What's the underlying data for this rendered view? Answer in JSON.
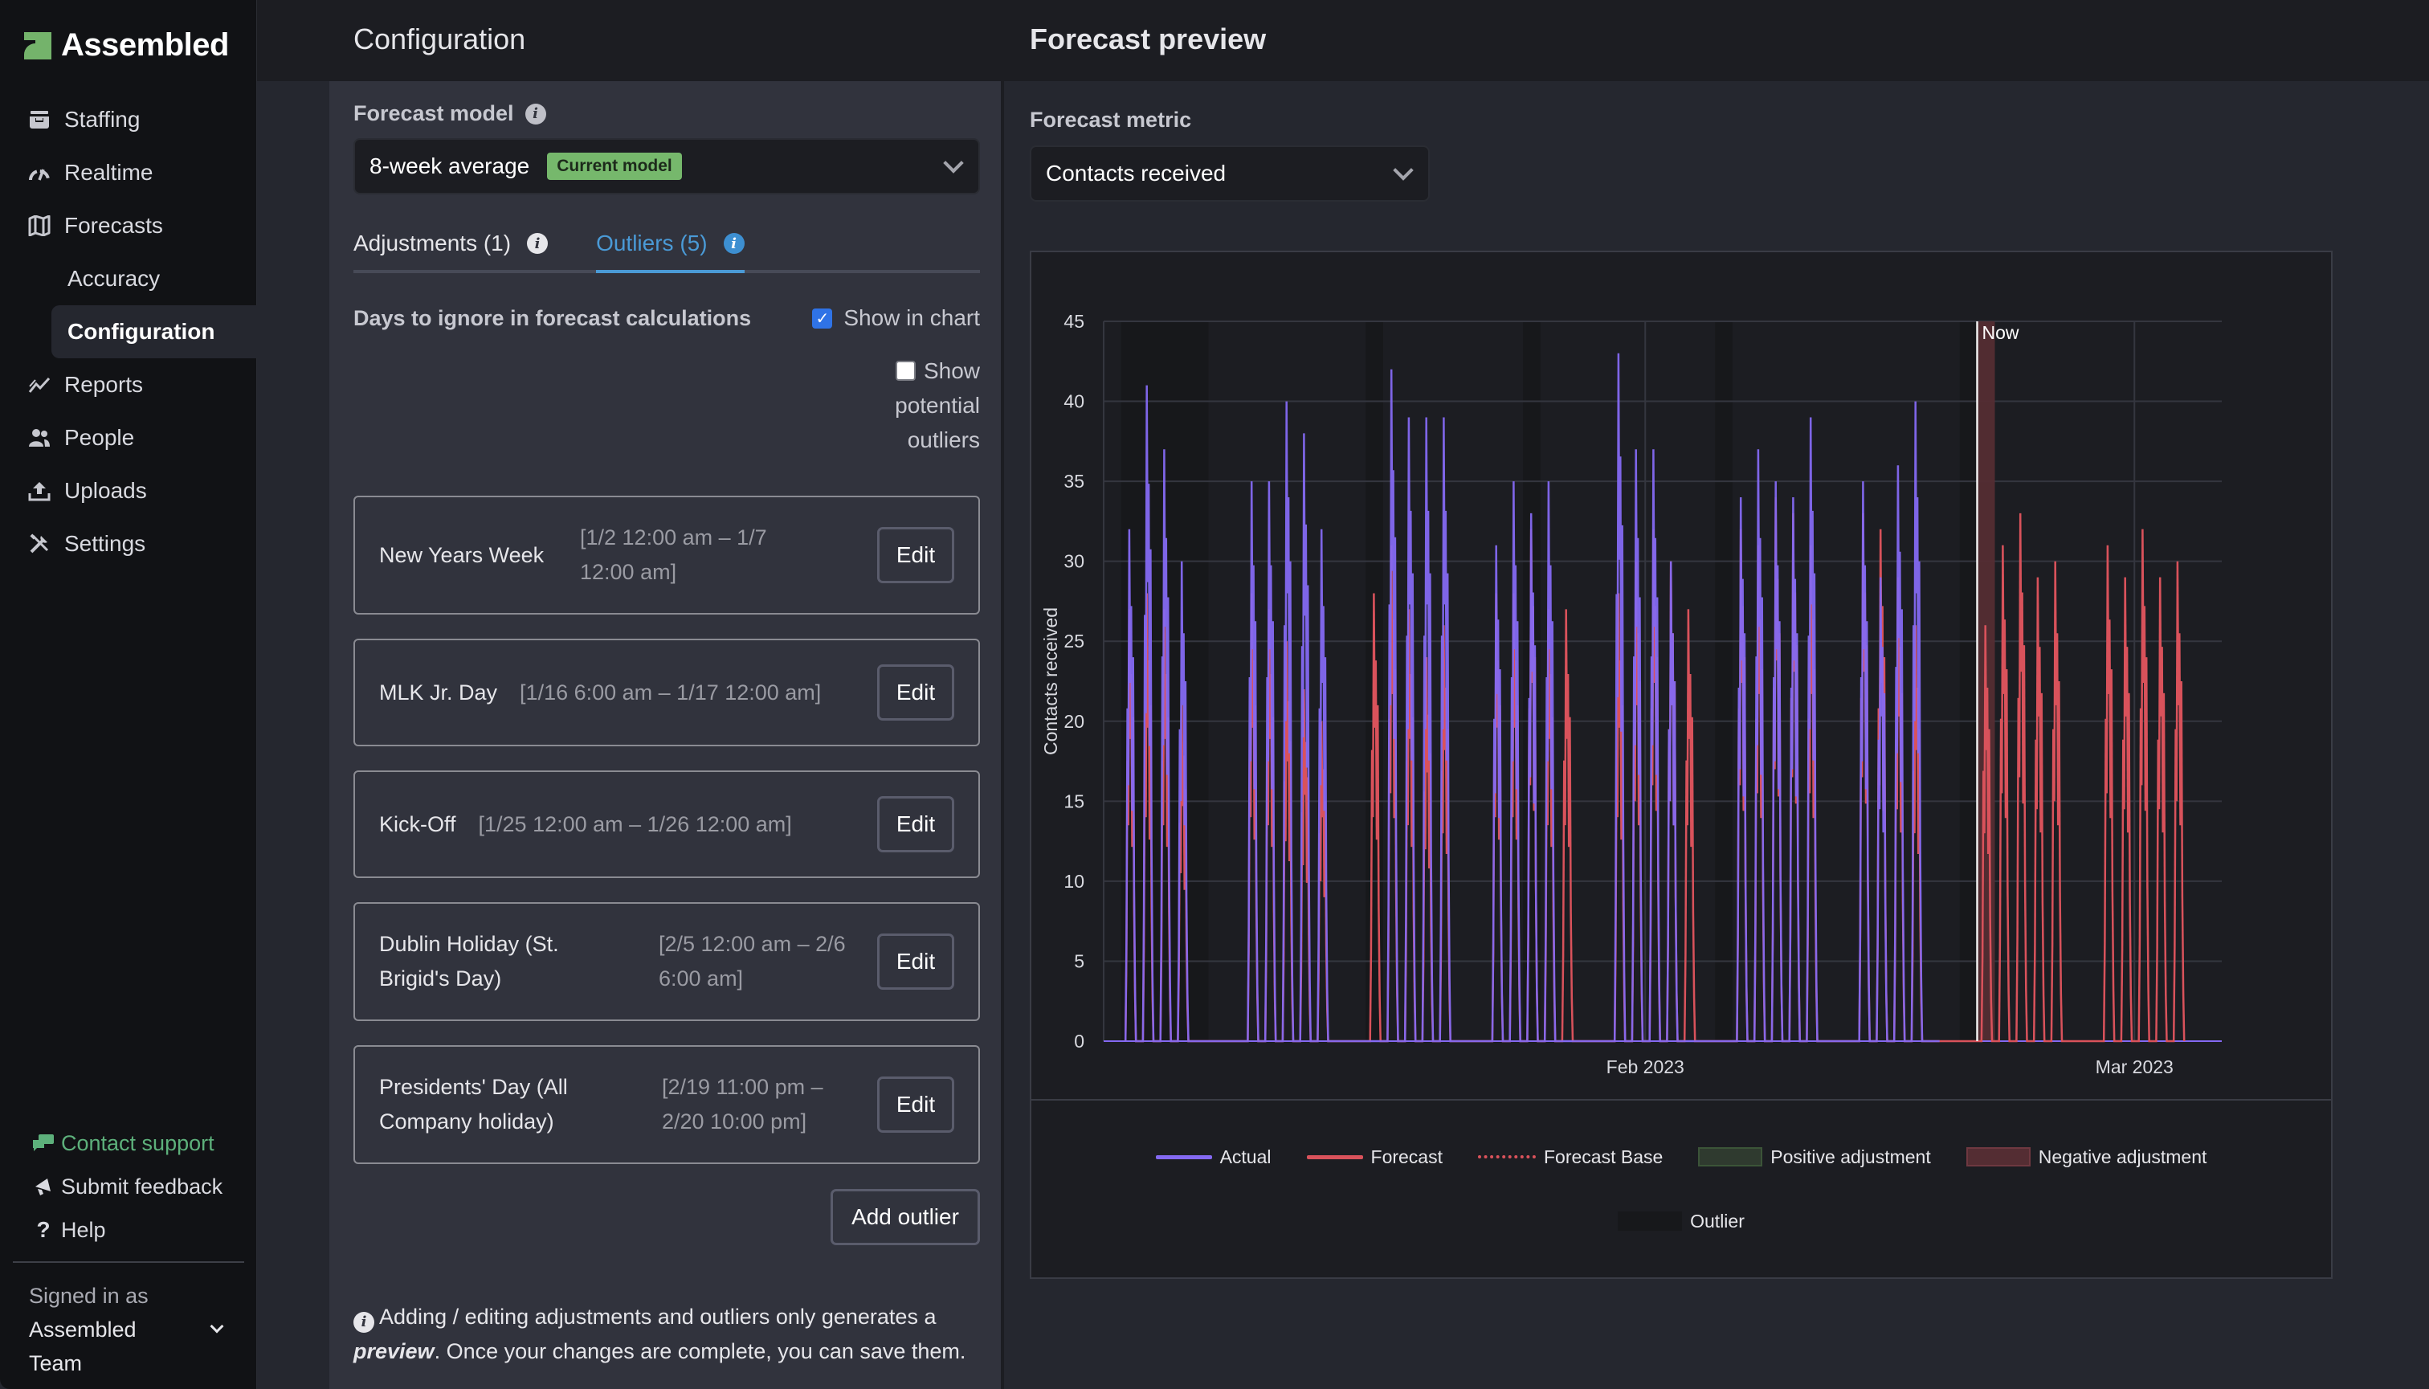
{
  "brand": {
    "name": "Assembled",
    "accent": "#74b36b"
  },
  "sidebar": {
    "items": [
      {
        "label": "Staffing",
        "icon": "inbox-tray-icon"
      },
      {
        "label": "Realtime",
        "icon": "gauge-icon"
      },
      {
        "label": "Forecasts",
        "icon": "map-icon"
      },
      {
        "label": "Accuracy",
        "sub": true
      },
      {
        "label": "Configuration",
        "sub": true,
        "active": true
      },
      {
        "label": "Reports",
        "icon": "chart-line-icon"
      },
      {
        "label": "People",
        "icon": "people-icon"
      },
      {
        "label": "Uploads",
        "icon": "upload-icon"
      },
      {
        "label": "Settings",
        "icon": "tools-icon"
      }
    ],
    "bottom": {
      "contact_support": "Contact support",
      "submit_feedback": "Submit feedback",
      "help": "Help",
      "signed_in_label": "Signed in as",
      "user_line1": "Assembled",
      "user_line2": "Team"
    }
  },
  "config": {
    "title": "Configuration",
    "forecast_model_label": "Forecast model",
    "forecast_model_value": "8-week average",
    "current_model_badge": "Current model",
    "tabs": [
      {
        "label": "Adjustments (1)",
        "active": false
      },
      {
        "label": "Outliers (5)",
        "active": true
      }
    ],
    "section_title": "Days to ignore in forecast calculations",
    "show_in_chart": {
      "label": "Show in chart",
      "checked": true
    },
    "show_potential": {
      "label": "Show potential outliers",
      "checked": false
    },
    "outliers": [
      {
        "name": "New Years Week",
        "range": "[1/2 12:00 am – 1/7 12:00 am]",
        "edit": "Edit"
      },
      {
        "name": "MLK Jr. Day",
        "range": "[1/16 6:00 am – 1/17 12:00 am]",
        "edit": "Edit"
      },
      {
        "name": "Kick-Off",
        "range": "[1/25 12:00 am – 1/26 12:00 am]",
        "edit": "Edit"
      },
      {
        "name": "Dublin Holiday (St. Brigid's Day)",
        "range": "[2/5 12:00 am – 2/6 6:00 am]",
        "edit": "Edit"
      },
      {
        "name": "Presidents' Day (All Company holiday)",
        "range": "[2/19 11:00 pm – 2/20 10:00 pm]",
        "edit": "Edit"
      }
    ],
    "add_outlier": "Add outlier",
    "note_prefix": "Adding / editing adjustments and outliers only generates a",
    "note_emphasis": "preview",
    "note_suffix": ". Once your changes are complete, you can save them."
  },
  "preview": {
    "title": "Forecast preview",
    "metric_label": "Forecast metric",
    "metric_value": "Contacts received"
  },
  "chart_data": {
    "type": "line",
    "title": "",
    "xlabel": "",
    "ylabel": "Contacts received",
    "ylim": [
      0,
      45
    ],
    "yticks": [
      0,
      5,
      10,
      15,
      20,
      25,
      30,
      35,
      40,
      45
    ],
    "x_range": [
      "2023-01-01",
      "2023-03-06"
    ],
    "xticks": [
      {
        "label": "Feb 2023",
        "date": "2023-02-01"
      },
      {
        "label": "Mar 2023",
        "date": "2023-03-01"
      }
    ],
    "now_marker": {
      "label": "Now",
      "date": "2023-02-20"
    },
    "grid": true,
    "legend_position": "bottom",
    "legend": [
      "Actual",
      "Forecast",
      "Forecast Base",
      "Positive adjustment",
      "Negative adjustment",
      "Outlier"
    ],
    "colors": {
      "actual": "#8469f2",
      "forecast": "#d9525b",
      "forecast_base": "#d9525b",
      "positive_adjustment": "#2f3a2f",
      "negative_adjustment": "#542d33",
      "outlier": "#17181b"
    },
    "outlier_ranges": [
      [
        "2023-01-02",
        "2023-01-07"
      ],
      [
        "2023-01-16",
        "2023-01-17"
      ],
      [
        "2023-01-25",
        "2023-01-26"
      ],
      [
        "2023-02-05",
        "2023-02-06"
      ],
      [
        "2023-02-19",
        "2023-02-20"
      ]
    ],
    "negative_adjustment_ranges": [
      [
        "2023-02-20",
        "2023-02-21"
      ]
    ],
    "daily_peaks": {
      "note": "Approximate daily peak values (contacts per interval); weekends near 0",
      "dates": [
        "01-02",
        "01-03",
        "01-04",
        "01-05",
        "01-06",
        "01-09",
        "01-10",
        "01-11",
        "01-12",
        "01-13",
        "01-16",
        "01-17",
        "01-18",
        "01-19",
        "01-20",
        "01-23",
        "01-24",
        "01-25",
        "01-26",
        "01-27",
        "01-30",
        "01-31",
        "02-01",
        "02-02",
        "02-03",
        "02-06",
        "02-07",
        "02-08",
        "02-09",
        "02-10",
        "02-13",
        "02-14",
        "02-15",
        "02-16",
        "02-17",
        "02-20",
        "02-21",
        "02-22",
        "02-23",
        "02-24",
        "02-27",
        "02-28",
        "03-01",
        "03-02",
        "03-03"
      ],
      "actual": [
        32,
        41,
        37,
        30,
        0,
        35,
        35,
        40,
        38,
        32,
        0,
        42,
        39,
        39,
        39,
        31,
        35,
        33,
        35,
        0,
        43,
        37,
        37,
        30,
        0,
        34,
        37,
        35,
        34,
        39,
        35,
        29,
        36,
        40,
        0,
        null,
        null,
        null,
        null,
        null,
        null,
        null,
        null,
        null,
        null
      ],
      "forecast": [
        27,
        28,
        27,
        21,
        0,
        28,
        27,
        25,
        22,
        20,
        28,
        31,
        27,
        24,
        26,
        28,
        28,
        32,
        27,
        27,
        28,
        30,
        32,
        30,
        27,
        32,
        31,
        34,
        33,
        31,
        33,
        32,
        29,
        26,
        0,
        26,
        31,
        33,
        29,
        30,
        31,
        29,
        32,
        29,
        30
      ]
    }
  }
}
